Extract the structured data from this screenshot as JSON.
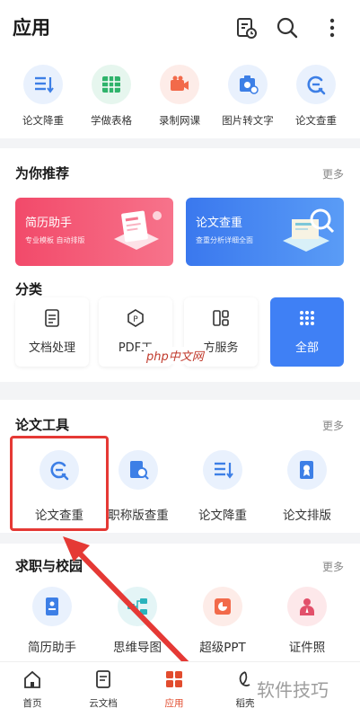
{
  "header": {
    "title": "应用"
  },
  "quick_tools": [
    {
      "label": "论文降重",
      "icon": "list-down-icon"
    },
    {
      "label": "学做表格",
      "icon": "table-icon"
    },
    {
      "label": "录制网课",
      "icon": "video-camera-icon"
    },
    {
      "label": "图片转文字",
      "icon": "image-text-icon"
    },
    {
      "label": "论文查重",
      "icon": "search-check-icon"
    }
  ],
  "recommend": {
    "title": "为你推荐",
    "more": "更多",
    "banners": [
      {
        "title": "简历助手",
        "subtitle": "专业模板 自动排版",
        "color": "#f0516f"
      },
      {
        "title": "论文查重",
        "subtitle": "查重分析详细全面",
        "color": "#3d80f2"
      }
    ]
  },
  "category": {
    "title": "分类",
    "items": [
      {
        "label": "文档处理",
        "icon": "document-icon"
      },
      {
        "label": "PDF工",
        "icon": "pdf-icon"
      },
      {
        "label": "方服务",
        "icon": "grid-panel-icon"
      },
      {
        "label": "全部",
        "icon": "dots-grid-icon"
      }
    ],
    "overlay_text": "php中文网"
  },
  "paper_tools": {
    "title": "论文工具",
    "more": "更多",
    "items": [
      {
        "label": "论文查重",
        "icon": "search-check-icon"
      },
      {
        "label": "职称版查重",
        "icon": "document-search-icon"
      },
      {
        "label": "论文降重",
        "icon": "list-down-icon"
      },
      {
        "label": "论文排版",
        "icon": "document-badge-icon"
      }
    ]
  },
  "job_tools": {
    "title": "求职与校园",
    "more": "更多",
    "items": [
      {
        "label": "简历助手",
        "icon": "resume-icon"
      },
      {
        "label": "思维导图",
        "icon": "mindmap-icon"
      },
      {
        "label": "超级PPT",
        "icon": "ppt-icon"
      },
      {
        "label": "证件照",
        "icon": "id-photo-icon"
      }
    ]
  },
  "bottom_nav": [
    {
      "label": "首页",
      "icon": "home-icon"
    },
    {
      "label": "云文档",
      "icon": "cloud-doc-icon"
    },
    {
      "label": "应用",
      "icon": "apps-icon",
      "active": true
    },
    {
      "label": "稻壳",
      "icon": "docer-icon"
    }
  ],
  "watermark": "软件技巧",
  "colors": {
    "accent": "#3f80f5",
    "highlight_box": "#e53935",
    "banner_red": "#f0516f",
    "banner_blue": "#3d80f2"
  }
}
